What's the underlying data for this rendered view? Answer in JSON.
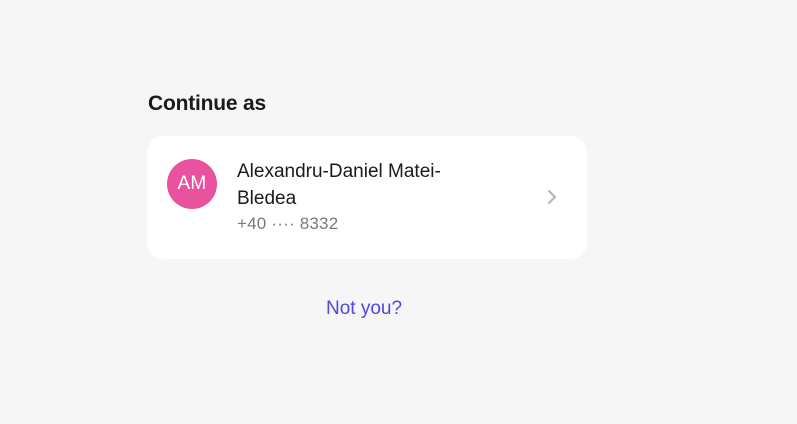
{
  "heading": "Continue as",
  "account": {
    "initials": "AM",
    "name": "Alexandru-Daniel Matei-Bledea",
    "phone": "+40 ···· 8332",
    "avatar_color": "#e8529f",
    "chevron_icon": "chevron-right"
  },
  "links": {
    "not_you": "Not you?"
  },
  "colors": {
    "link": "#4f46e5",
    "background": "#f6f6f6",
    "chevron": "#b4b8bd"
  }
}
